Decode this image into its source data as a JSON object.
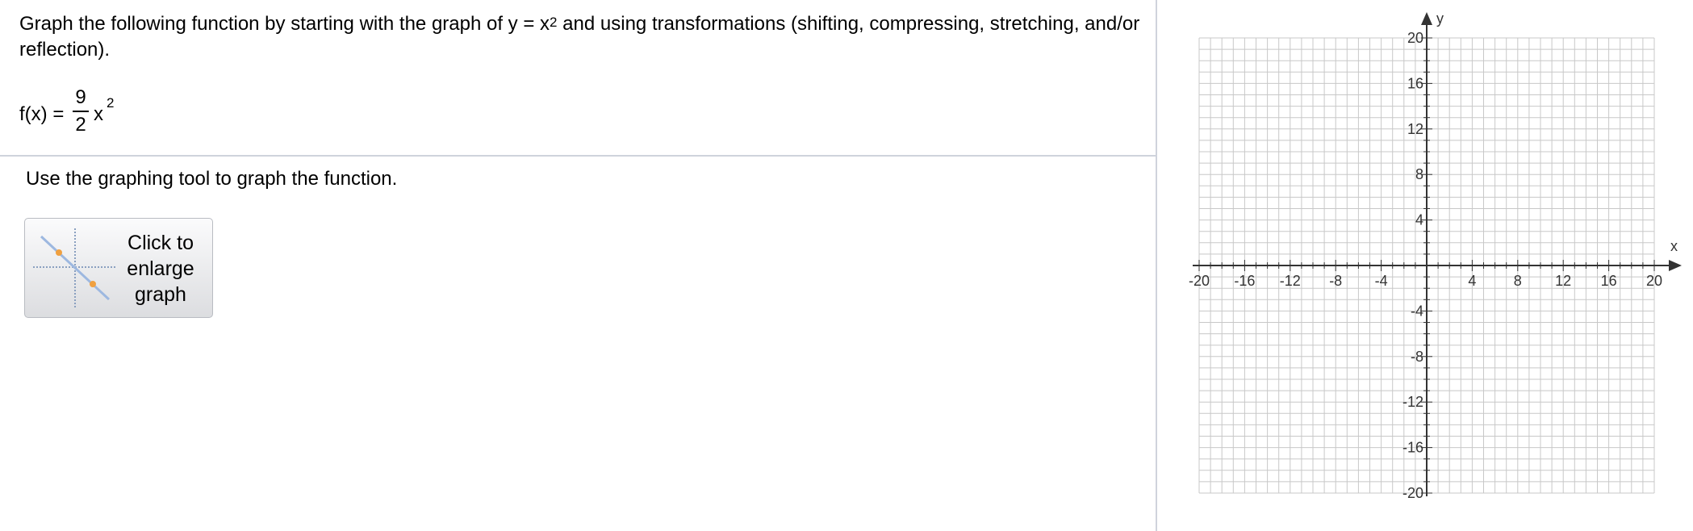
{
  "question": {
    "text_before": "Graph the following function by starting with the graph of y = x",
    "exponent": "2",
    "text_after": " and using transformations (shifting, compressing, stretching, and/or reflection)."
  },
  "function": {
    "lhs": "f(x) =",
    "numerator": "9",
    "denominator": "2",
    "variable": "x",
    "exponent": "2"
  },
  "instruction": "Use the graphing tool to graph the function.",
  "enlarge_button": {
    "label": "Click to enlarge graph"
  },
  "graph": {
    "x_axis_label": "x",
    "y_axis_label": "y",
    "x_range": [
      -20,
      20
    ],
    "y_range": [
      -20,
      20
    ],
    "grid_step": 1,
    "label_step": 4,
    "x_tick_labels": [
      "-20",
      "-16",
      "-12",
      "-8",
      "-4",
      "4",
      "8",
      "12",
      "16",
      "20"
    ],
    "y_tick_labels": [
      "20",
      "16",
      "12",
      "8",
      "4",
      "-4",
      "-8",
      "-12",
      "-16",
      "-20"
    ],
    "colors": {
      "grid": "#c8c8c8",
      "axis": "#333333",
      "thumb_line": "#9db8e0",
      "thumb_point": "#f0a040"
    }
  }
}
